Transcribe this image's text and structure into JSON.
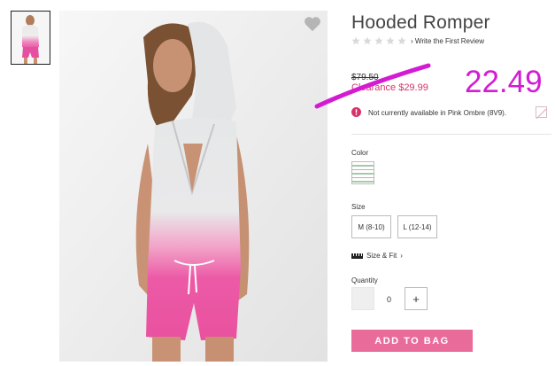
{
  "gallery": {
    "thumbnail_alt": "Hooded Romper thumbnail",
    "main_image_alt": "Model wearing Hooded Romper in Pink Ombre"
  },
  "product": {
    "title": "Hooded Romper",
    "review_link": "Write the First Review",
    "rating": 0,
    "rating_max": 5
  },
  "price": {
    "was": "$79.50",
    "clearance": "Clearance $29.99",
    "handwritten_price": "22.49"
  },
  "availability": {
    "message": "Not currently available in Pink Ombre (8V9)."
  },
  "options": {
    "color_label": "Color",
    "size_label": "Size",
    "sizes": [
      "M (8-10)",
      "L (12-14)"
    ],
    "size_fit_label": "Size & Fit",
    "quantity_label": "Quantity",
    "quantity_value": "0",
    "plus_label": "+"
  },
  "actions": {
    "add_to_bag": "ADD TO BAG"
  },
  "colors": {
    "accent_pink": "#e96b9a",
    "clearance_red": "#d6336c",
    "annotation_magenta": "#d41bd4"
  }
}
